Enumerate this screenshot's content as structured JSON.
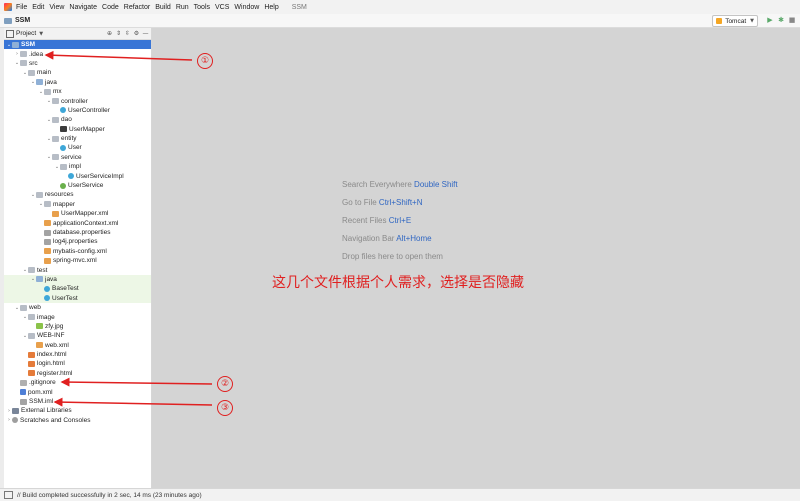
{
  "menu": {
    "items": [
      "File",
      "Edit",
      "View",
      "Navigate",
      "Code",
      "Refactor",
      "Build",
      "Run",
      "Tools",
      "VCS",
      "Window",
      "Help"
    ],
    "title": "SSM"
  },
  "navbar": {
    "project": "SSM",
    "run_config": "Tomcat"
  },
  "panel": {
    "title": "Project"
  },
  "tree": [
    {
      "label": "SSM",
      "icon": "folder-blue-icon",
      "depth": 0,
      "arrow": "down",
      "selected": true
    },
    {
      "label": ".idea",
      "icon": "folder-icon",
      "depth": 1,
      "arrow": "right"
    },
    {
      "label": "src",
      "icon": "folder-icon",
      "depth": 1,
      "arrow": "down"
    },
    {
      "label": "main",
      "icon": "folder-icon",
      "depth": 2,
      "arrow": "down"
    },
    {
      "label": "java",
      "icon": "folder-blue-icon",
      "depth": 3,
      "arrow": "down"
    },
    {
      "label": "mx",
      "icon": "folder-icon",
      "depth": 4,
      "arrow": "down"
    },
    {
      "label": "controller",
      "icon": "folder-icon",
      "depth": 5,
      "arrow": "down"
    },
    {
      "label": "UserController",
      "icon": "class-icon",
      "depth": 6,
      "arrow": ""
    },
    {
      "label": "dao",
      "icon": "folder-icon",
      "depth": 5,
      "arrow": "down"
    },
    {
      "label": "UserMapper",
      "icon": "dao-icon",
      "depth": 6,
      "arrow": ""
    },
    {
      "label": "entity",
      "icon": "folder-icon",
      "depth": 5,
      "arrow": "down"
    },
    {
      "label": "User",
      "icon": "class-icon",
      "depth": 6,
      "arrow": ""
    },
    {
      "label": "service",
      "icon": "folder-icon",
      "depth": 5,
      "arrow": "down"
    },
    {
      "label": "impl",
      "icon": "folder-icon",
      "depth": 6,
      "arrow": "down"
    },
    {
      "label": "UserServiceImpl",
      "icon": "class-icon",
      "depth": 7,
      "arrow": ""
    },
    {
      "label": "UserService",
      "icon": "interface-icon",
      "depth": 6,
      "arrow": ""
    },
    {
      "label": "resources",
      "icon": "folder-icon",
      "depth": 3,
      "arrow": "down"
    },
    {
      "label": "mapper",
      "icon": "folder-icon",
      "depth": 4,
      "arrow": "down"
    },
    {
      "label": "UserMapper.xml",
      "icon": "xml-icon",
      "depth": 5,
      "arrow": ""
    },
    {
      "label": "applicationContext.xml",
      "icon": "xml-icon",
      "depth": 4,
      "arrow": ""
    },
    {
      "label": "database.properties",
      "icon": "properties-icon",
      "depth": 4,
      "arrow": ""
    },
    {
      "label": "log4j.properties",
      "icon": "properties-icon",
      "depth": 4,
      "arrow": ""
    },
    {
      "label": "mybatis-config.xml",
      "icon": "xml-icon",
      "depth": 4,
      "arrow": ""
    },
    {
      "label": "spring-mvc.xml",
      "icon": "xml-icon",
      "depth": 4,
      "arrow": ""
    },
    {
      "label": "test",
      "icon": "folder-icon",
      "depth": 2,
      "arrow": "down"
    },
    {
      "label": "java",
      "icon": "folder-blue-icon",
      "depth": 3,
      "arrow": "down",
      "test": true
    },
    {
      "label": "BaseTest",
      "icon": "class-icon",
      "depth": 4,
      "arrow": "",
      "test": true
    },
    {
      "label": "UserTest",
      "icon": "class-icon",
      "depth": 4,
      "arrow": "",
      "test": true
    },
    {
      "label": "web",
      "icon": "folder-icon",
      "depth": 1,
      "arrow": "down"
    },
    {
      "label": "image",
      "icon": "folder-icon",
      "depth": 2,
      "arrow": "down"
    },
    {
      "label": "zfy.jpg",
      "icon": "image-icon",
      "depth": 3,
      "arrow": ""
    },
    {
      "label": "WEB-INF",
      "icon": "folder-icon",
      "depth": 2,
      "arrow": "down"
    },
    {
      "label": "web.xml",
      "icon": "xml-icon",
      "depth": 3,
      "arrow": ""
    },
    {
      "label": "index.html",
      "icon": "html-icon",
      "depth": 2,
      "arrow": ""
    },
    {
      "label": "login.html",
      "icon": "html-icon",
      "depth": 2,
      "arrow": ""
    },
    {
      "label": "register.html",
      "icon": "html-icon",
      "depth": 2,
      "arrow": ""
    },
    {
      "label": ".gitignore",
      "icon": "git-icon",
      "depth": 1,
      "arrow": ""
    },
    {
      "label": "pom.xml",
      "icon": "maven-icon",
      "depth": 1,
      "arrow": ""
    },
    {
      "label": "SSM.iml",
      "icon": "iml-icon",
      "depth": 1,
      "arrow": ""
    },
    {
      "label": "External Libraries",
      "icon": "library-icon",
      "depth": 0,
      "arrow": "right"
    },
    {
      "label": "Scratches and Consoles",
      "icon": "scratch-icon",
      "depth": 0,
      "arrow": "right"
    }
  ],
  "editor_hints": [
    {
      "text": "Search Everywhere",
      "key": "Double Shift"
    },
    {
      "text": "Go to File",
      "key": "Ctrl+Shift+N"
    },
    {
      "text": "Recent Files",
      "key": "Ctrl+E"
    },
    {
      "text": "Navigation Bar",
      "key": "Alt+Home"
    },
    {
      "text": "Drop files here to open them",
      "key": ""
    }
  ],
  "annotation": "这几个文件根据个人需求，选择是否隐藏",
  "markers": [
    "①",
    "②",
    "③"
  ],
  "status": "// Build completed successfully in 2 sec, 14 ms (23 minutes ago)",
  "colors": {
    "selection": "#3875d6",
    "annotation": "#e02020",
    "editor_bg": "#d4d4d4",
    "key": "#2f66c2"
  }
}
